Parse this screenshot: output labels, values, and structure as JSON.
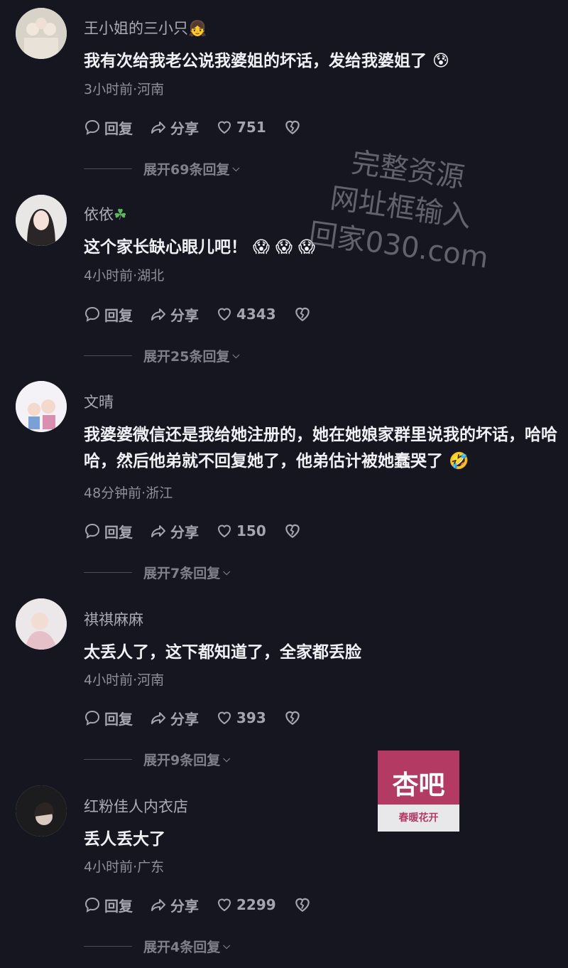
{
  "comments": [
    {
      "username": "王小姐的三小只",
      "username_emoji": "👧",
      "text": "我有次给我老公说我婆姐的坏话，发给我婆姐了 😰",
      "meta": "3小时前·河南",
      "reply_label": "回复",
      "share_label": "分享",
      "likes": "751",
      "expand_label": "展开69条回复"
    },
    {
      "username": "依依",
      "username_emoji": "☘",
      "text": "这个家长缺心眼儿吧！ 😱 😱 😱",
      "meta": "4小时前·湖北",
      "reply_label": "回复",
      "share_label": "分享",
      "likes": "4343",
      "expand_label": "展开25条回复"
    },
    {
      "username": "文晴",
      "username_emoji": "",
      "text": "我婆婆微信还是我给她注册的，她在她娘家群里说我的坏话，哈哈哈，然后他弟就不回复她了，他弟估计被她蠢哭了 🤣",
      "meta": "48分钟前·浙江",
      "reply_label": "回复",
      "share_label": "分享",
      "likes": "150",
      "expand_label": "展开7条回复"
    },
    {
      "username": "祺祺麻麻",
      "username_emoji": "",
      "text": "太丢人了，这下都知道了，全家都丢脸",
      "meta": "4小时前·河南",
      "reply_label": "回复",
      "share_label": "分享",
      "likes": "393",
      "expand_label": "展开9条回复"
    },
    {
      "username": "红粉佳人内衣店",
      "username_emoji": "",
      "text": "丢人丢大了",
      "meta": "4小时前·广东",
      "reply_label": "回复",
      "share_label": "分享",
      "likes": "2299",
      "expand_label": "展开4条回复"
    }
  ],
  "watermark": {
    "line1": "完整资源",
    "line2": "网址框输入",
    "line3": "回家030.com"
  },
  "logo": {
    "title": "杏吧",
    "subtitle": "春暖花开"
  },
  "colors": {
    "background": "#15161f",
    "logo_brand": "#b23a63"
  }
}
